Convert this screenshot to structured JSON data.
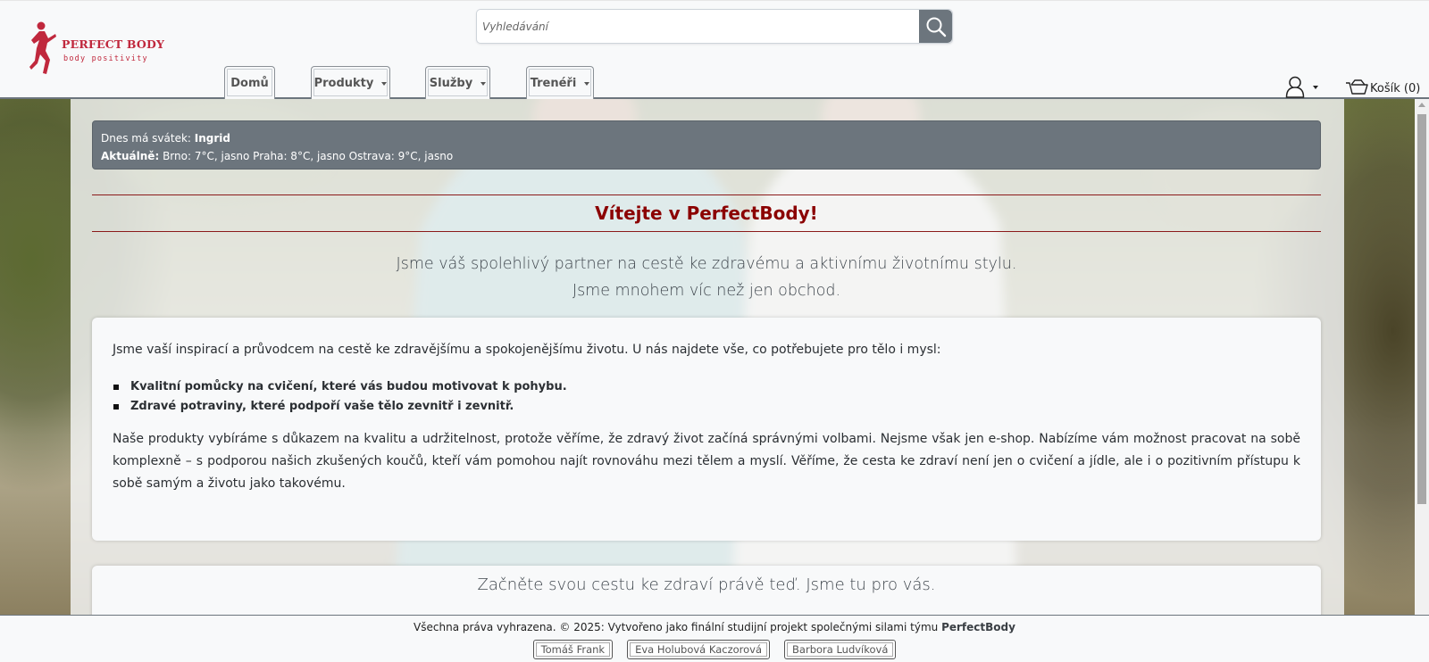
{
  "brand": {
    "name": "PERFECT BODY",
    "tagline": "body positivity",
    "accent": "#c0283d"
  },
  "search": {
    "placeholder": "Vyhledávání",
    "icon": "search-icon"
  },
  "nav": {
    "home": "Domů",
    "products": "Produkty",
    "services": "Služby",
    "trainers": "Trenéři"
  },
  "account": {
    "icon": "user-icon"
  },
  "cart": {
    "label": "Košík (0)",
    "icon": "cart-icon"
  },
  "info_bar": {
    "nameday_label": "Dnes má svátek:",
    "nameday_name": "Ingrid",
    "weather_label": "Aktuálně:",
    "weather_text": "Brno: 7°C, jasno Praha: 8°C, jasno Ostrava: 9°C, jasno"
  },
  "welcome_title": "Vítejte v PerfectBody!",
  "lead": {
    "line1": "Jsme váš spolehlivý partner na cestě ke zdravému a aktivnímu životnímu stylu.",
    "line2": "Jsme mnohem víc než jen obchod."
  },
  "about": {
    "intro": "Jsme vaší inspirací a průvodcem na cestě ke zdravějšímu a spokojenějšímu životu. U nás najdete vše, co potřebujete pro tělo i mysl:",
    "bullets": [
      "Kvalitní pomůcky na cvičení, které vás budou motivovat k pohybu.",
      "Zdravé potraviny, které podpoří vaše tělo zevnitř i zevnitř."
    ],
    "body": "Naše produkty vybíráme s důkazem na kvalitu a udržitelnost, protože věříme, že zdravý život začíná správnými volbami. Nejsme však jen e-shop. Nabízíme vám možnost pracovat na sobě komplexně – s podporou našich zkušených koučů, kteří vám pomohou najít rovnováhu mezi tělem a myslí. Věříme, že cesta ke zdraví není jen o cvičení a jídle, ale i o pozitivním přístupu k sobě samým a životu jako takovému."
  },
  "cta": "Začněte svou cestu ke zdraví právě teď. Jsme tu pro vás.",
  "footer": {
    "text": "Všechna práva vyhrazena. © 2025: Vytvořeno jako finální studijní projekt společnými silami týmu",
    "team": "PerfectBody",
    "authors": [
      "Tomáš Frank",
      "Eva Holubová Kaczorová",
      "Barbora Ludvíková"
    ]
  },
  "colors": {
    "header_bg": "#f8f9fa",
    "info_bar_bg": "#6c757d",
    "title_red": "#8b0000",
    "search_btn": "#6c757d"
  }
}
